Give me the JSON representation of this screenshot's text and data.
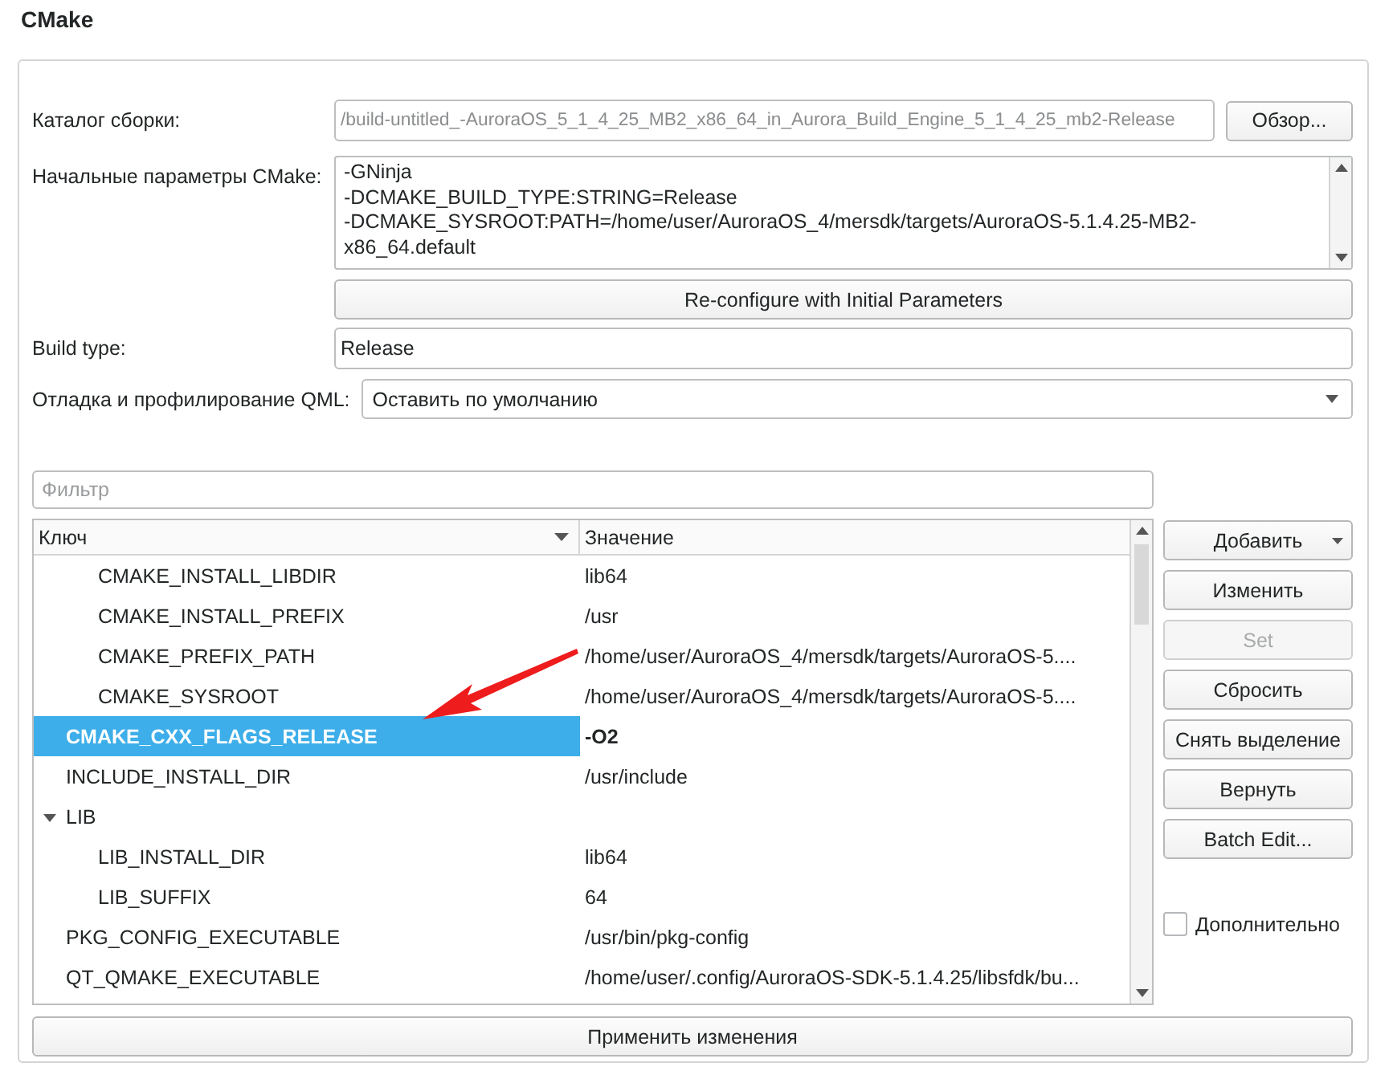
{
  "section_title": "CMake",
  "build_dir": {
    "label": "Каталог сборки:",
    "value": "/build-untitled_-AuroraOS_5_1_4_25_MB2_x86_64_in_Aurora_Build_Engine_5_1_4_25_mb2-Release",
    "disabled": true,
    "browse_button": "Обзор..."
  },
  "initial_params": {
    "label": "Начальные параметры CMake:",
    "lines": [
      "-GNinja",
      "-DCMAKE_BUILD_TYPE:STRING=Release",
      "-DCMAKE_SYSROOT:PATH=/home/user/AuroraOS_4/mersdk/targets/AuroraOS-5.1.4.25-MB2-",
      "x86_64.default"
    ]
  },
  "reconfigure_button": "Re-configure with Initial Parameters",
  "build_type": {
    "label": "Build type:",
    "value": "Release"
  },
  "qml_debug": {
    "label": "Отладка и профилирование QML:",
    "value": "Оставить по умолчанию"
  },
  "filter": {
    "placeholder": "Фильтр"
  },
  "table": {
    "columns": [
      "Ключ",
      "Значение"
    ],
    "rows": [
      {
        "children": [
          {
            "key": "CMAKE_INSTALL_LIBDIR",
            "value": "lib64",
            "selected": false,
            "changed": false
          },
          {
            "key": "CMAKE_INSTALL_PREFIX",
            "value": "/usr",
            "selected": false,
            "changed": false
          },
          {
            "key": "CMAKE_PREFIX_PATH",
            "value": "/home/user/AuroraOS_4/mersdk/targets/AuroraOS-5....",
            "selected": false,
            "changed": false
          },
          {
            "key": "CMAKE_SYSROOT",
            "value": "/home/user/AuroraOS_4/mersdk/targets/AuroraOS-5....",
            "selected": false,
            "changed": false
          }
        ]
      },
      {
        "key": "CMAKE_CXX_FLAGS_RELEASE",
        "value": "-O2",
        "selected": true,
        "changed": true
      },
      {
        "key": "INCLUDE_INSTALL_DIR",
        "value": "/usr/include",
        "selected": false,
        "changed": false
      },
      {
        "key": "LIB",
        "expanded": true,
        "selected": false,
        "children": [
          {
            "key": "LIB_INSTALL_DIR",
            "value": "lib64",
            "selected": false,
            "changed": false
          },
          {
            "key": "LIB_SUFFIX",
            "value": "64",
            "selected": false,
            "changed": false
          }
        ]
      },
      {
        "key": "PKG_CONFIG_EXECUTABLE",
        "value": "/usr/bin/pkg-config",
        "selected": false,
        "changed": false
      },
      {
        "key": "QT_QMAKE_EXECUTABLE",
        "value": "/home/user/.config/AuroraOS-SDK-5.1.4.25/libsfdk/bu...",
        "selected": false,
        "changed": false
      }
    ]
  },
  "side_buttons": [
    {
      "label": "Добавить",
      "kind": "dropdown",
      "disabled": false
    },
    {
      "label": "Изменить",
      "kind": "plain",
      "disabled": false
    },
    {
      "label": "Set",
      "kind": "plain",
      "disabled": true
    },
    {
      "label": "Сбросить",
      "kind": "plain",
      "disabled": false
    },
    {
      "label": "Снять выделение",
      "kind": "plain",
      "disabled": false
    },
    {
      "label": "Вернуть",
      "kind": "plain",
      "disabled": false
    },
    {
      "label": "Batch Edit...",
      "kind": "plain",
      "disabled": false
    }
  ],
  "advanced": {
    "label": "Дополнительно",
    "checked": false
  },
  "apply_button": "Применить изменения"
}
